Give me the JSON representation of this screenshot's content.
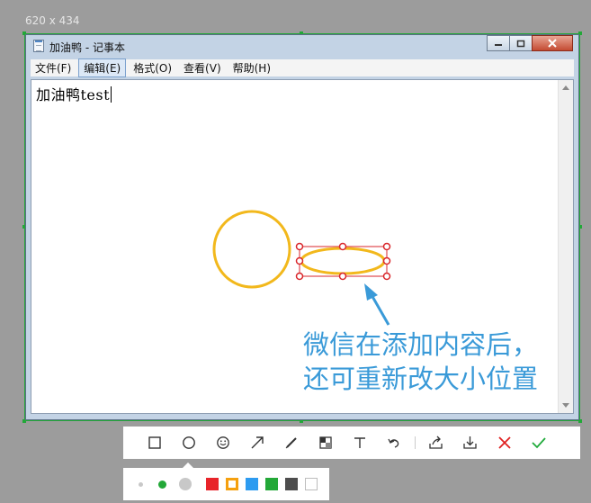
{
  "screen": {
    "dimensions_label": "620 x 434"
  },
  "window": {
    "title": "加油鸭 - 记事本",
    "controls": {
      "minimize_icon": "minimize-icon",
      "maximize_icon": "maximize-icon",
      "close_icon": "close-icon"
    }
  },
  "menu": {
    "items": [
      {
        "label": "文件(F)"
      },
      {
        "label": "编辑(E)"
      },
      {
        "label": "格式(O)"
      },
      {
        "label": "查看(V)"
      },
      {
        "label": "帮助(H)"
      }
    ],
    "active": "编辑(E)"
  },
  "editor": {
    "text": "加油鸭test"
  },
  "annotation": {
    "note_lines": [
      "微信在添加内容后，",
      "还可重新改大小位置"
    ],
    "colors": {
      "shape": "#f2b81c",
      "selection": "#d9262b",
      "arrow": "#3a9ad8"
    }
  },
  "toolbar": {
    "tools": [
      "rectangle-icon",
      "ellipse-icon",
      "emoji-icon",
      "arrow-icon",
      "pen-icon",
      "mosaic-icon",
      "text-icon",
      "undo-icon",
      "share-icon",
      "download-icon",
      "cancel-icon",
      "confirm-icon"
    ],
    "active_tool": "ellipse-icon"
  },
  "style_panel": {
    "sizes": [
      "small",
      "medium",
      "large"
    ],
    "selected_size": "medium",
    "colors": [
      "#e8242a",
      "#f5a00f",
      "#2d9bf0",
      "#23a838",
      "#4d4d4d",
      "#ffffff"
    ],
    "selected_color": "#f5a00f"
  }
}
